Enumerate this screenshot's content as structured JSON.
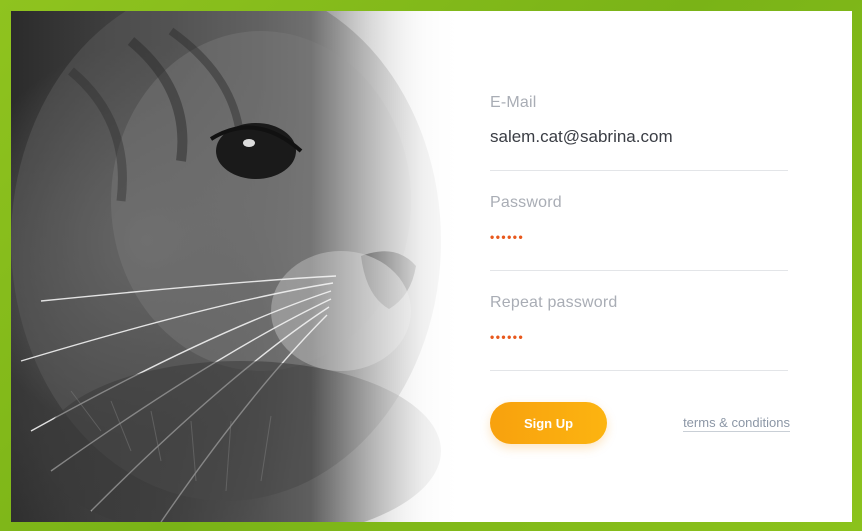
{
  "form": {
    "email": {
      "label": "E-Mail",
      "value": "salem.cat@sabrina.com"
    },
    "password": {
      "label": "Password",
      "masked": "••••••"
    },
    "repeat_password": {
      "label": "Repeat password",
      "masked": "••••••"
    },
    "signup_label": "Sign Up",
    "terms_label": "terms & conditions"
  },
  "colors": {
    "frame": "#8fc31f",
    "accent": "#f8a10e",
    "password_dots": "#e8581c",
    "label": "#a9adb5",
    "underline": "#e3e5e8"
  },
  "photo": {
    "subject": "cat-photo"
  }
}
